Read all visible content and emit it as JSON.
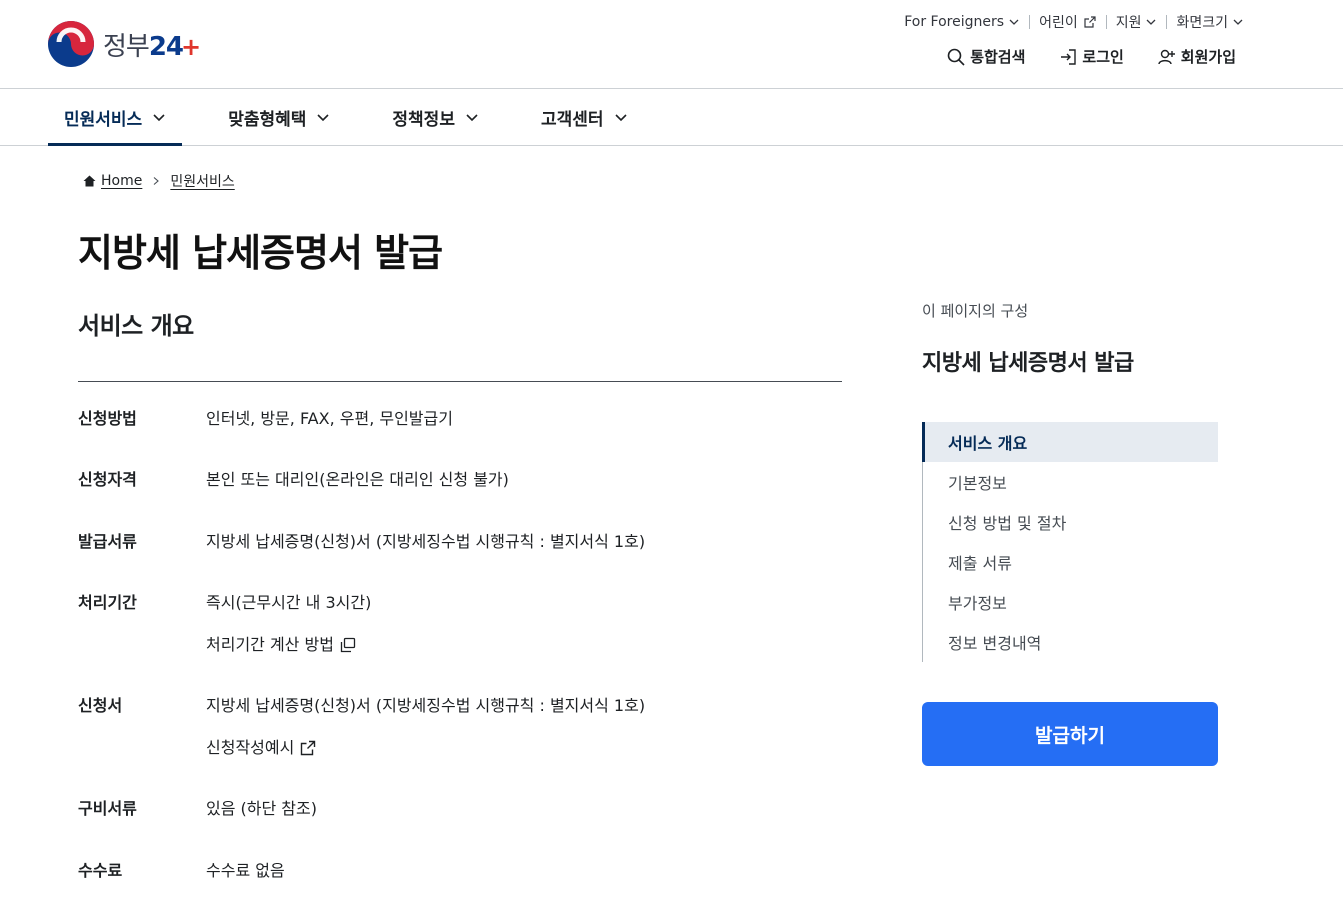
{
  "header": {
    "logo_text": "정부",
    "logo_num": "24",
    "utility": [
      {
        "label": "For Foreigners",
        "icon": "chevron-down-icon"
      },
      {
        "label": "어린이",
        "icon": "external-link-icon"
      },
      {
        "label": "지원",
        "icon": "chevron-down-icon"
      },
      {
        "label": "화면크기",
        "icon": "chevron-down-icon"
      }
    ],
    "account": {
      "search": "통합검색",
      "login": "로그인",
      "signup": "회원가입"
    }
  },
  "gnb": {
    "items": [
      {
        "label": "민원서비스",
        "active": true
      },
      {
        "label": "맞춤형혜택",
        "active": false
      },
      {
        "label": "정책정보",
        "active": false
      },
      {
        "label": "고객센터",
        "active": false
      }
    ]
  },
  "breadcrumb": {
    "home": "Home",
    "current": "민원서비스"
  },
  "page_title": "지방세 납세증명서 발급",
  "section_title": "서비스 개요",
  "info_rows": [
    {
      "label": "신청방법",
      "value": "인터넷, 방문, FAX, 우편, 무인발급기"
    },
    {
      "label": "신청자격",
      "value": "본인 또는 대리인(온라인은 대리인 신청 불가)"
    },
    {
      "label": "발급서류",
      "value": "지방세 납세증명(신청)서 (지방세징수법 시행규칙 : 별지서식 1호)"
    },
    {
      "label": "처리기간",
      "value": "즉시(근무시간 내 3시간)",
      "link": "처리기간 계산 방법"
    },
    {
      "label": "신청서",
      "value": "지방세 납세증명(신청)서 (지방세징수법 시행규칙 : 별지서식 1호)",
      "link": "신청작성예시"
    },
    {
      "label": "구비서류",
      "value": "있음 (하단 참조)"
    },
    {
      "label": "수수료",
      "value": "수수료 없음"
    }
  ],
  "side": {
    "caption": "이 페이지의 구성",
    "title": "지방세 납세증명서 발급",
    "toc": [
      {
        "label": "서비스 개요",
        "active": true
      },
      {
        "label": "기본정보",
        "active": false
      },
      {
        "label": "신청 방법 및 절차",
        "active": false
      },
      {
        "label": "제출 서류",
        "active": false
      },
      {
        "label": "부가정보",
        "active": false
      },
      {
        "label": "정보 변경내역",
        "active": false
      }
    ],
    "button": "발급하기"
  },
  "colors": {
    "primary": "#256ef4",
    "navy": "#052b57",
    "border": "#cdd1d5"
  }
}
